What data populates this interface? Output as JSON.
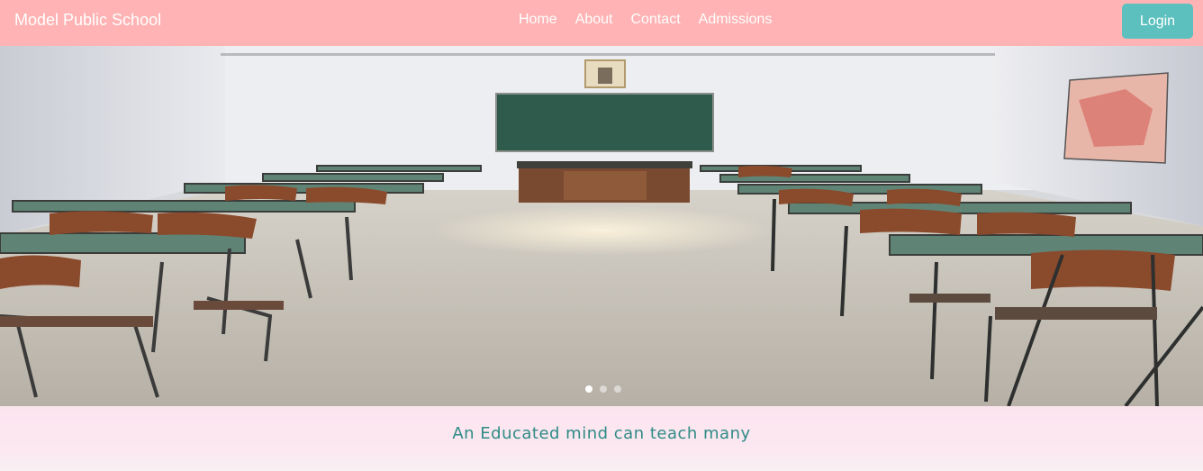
{
  "navbar": {
    "brand": "Model Public School",
    "links": [
      "Home",
      "About",
      "Contact",
      "Admissions"
    ],
    "login_label": "Login",
    "background": "#ffb3b4",
    "login_color": "#5bc0be"
  },
  "hero": {
    "slides_count": 3,
    "active_slide": 1
  },
  "tagline": {
    "text": "An Educated mind can teach many",
    "color": "#2e8b85"
  }
}
